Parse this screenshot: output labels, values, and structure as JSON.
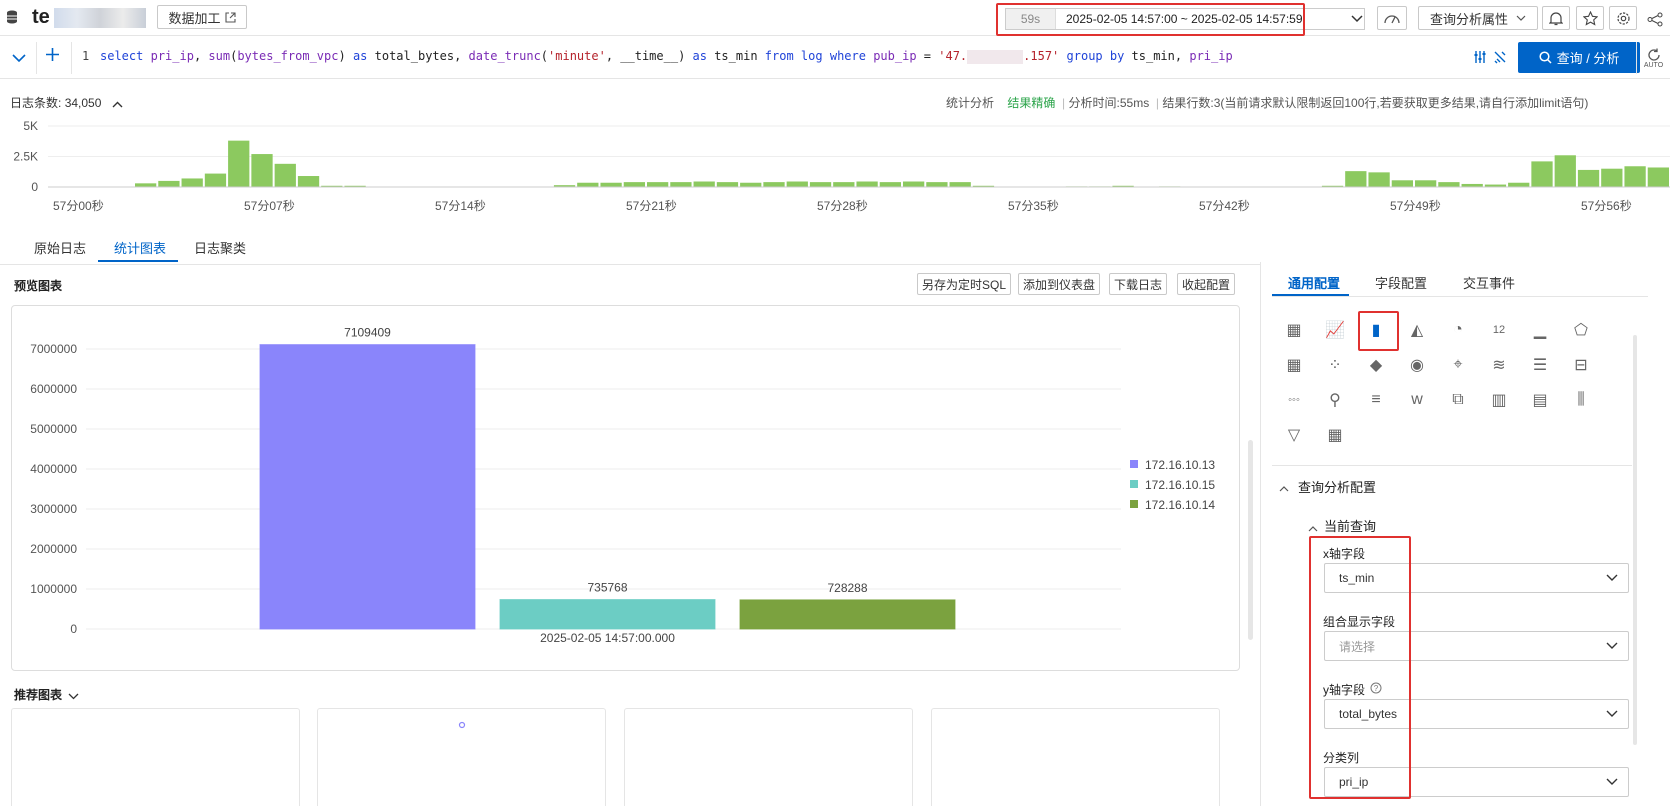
{
  "header": {
    "logstore_name": "te",
    "data_processing_label": "数据加工",
    "time_badge": "59s",
    "time_range": "2025-02-05 14:57:00 ~ 2025-02-05 14:57:59",
    "query_attr_label": "查询分析属性"
  },
  "query": {
    "line_no": "1",
    "run_label": "查询 / 分析",
    "auto_label": "AUTO"
  },
  "stats": {
    "log_count_label": "日志条数:",
    "log_count": "34,050",
    "analysis_label": "统计分析",
    "accuracy": "结果精确",
    "time_label": "分析时间:",
    "time_value": "55ms",
    "rows_label": "结果行数:",
    "rows_value": "3",
    "rows_note": "(当前请求默认限制返回100行,若要获取更多结果,请自行添加limit语句)"
  },
  "histogram": {
    "y_ticks": [
      "5K",
      "2.5K",
      "0"
    ],
    "x_ticks": [
      "57分00秒",
      "57分07秒",
      "57分14秒",
      "57分21秒",
      "57分28秒",
      "57分35秒",
      "57分42秒",
      "57分49秒",
      "57分56秒"
    ],
    "values": [
      0,
      0,
      0,
      0,
      0.3,
      0.5,
      0.7,
      1.1,
      3.8,
      2.7,
      1.9,
      0.9,
      0.1,
      0.1,
      0,
      0,
      0,
      0,
      0,
      0,
      0,
      0,
      0.15,
      0.35,
      0.35,
      0.4,
      0.4,
      0.4,
      0.45,
      0.4,
      0.35,
      0.4,
      0.45,
      0.4,
      0.4,
      0.45,
      0.4,
      0.45,
      0.4,
      0.4,
      0.1,
      0,
      0,
      0,
      0.05,
      0.05,
      0.1,
      0,
      0.05,
      0,
      0,
      0,
      0,
      0,
      0,
      0.1,
      1.3,
      1.2,
      0.55,
      0.55,
      0.4,
      0.25,
      0.2,
      0.35,
      2.1,
      2.6,
      1.4,
      1.5,
      1.7,
      1.6
    ]
  },
  "tabs": [
    "原始日志",
    "统计图表",
    "日志聚类"
  ],
  "preview": {
    "title": "预览图表",
    "buttons": [
      "另存为定时SQL",
      "添加到仪表盘",
      "下载日志",
      "收起配置"
    ]
  },
  "chart_data": {
    "type": "bar",
    "categories": [
      "2025-02-05 14:57:00.000"
    ],
    "series": [
      {
        "name": "172.16.10.13",
        "values": [
          7109409
        ],
        "color": "#8a85fb"
      },
      {
        "name": "172.16.10.15",
        "values": [
          735768
        ],
        "color": "#6ccdc4"
      },
      {
        "name": "172.16.10.14",
        "values": [
          728288
        ],
        "color": "#7ba23f"
      }
    ],
    "y_ticks": [
      0,
      1000000,
      2000000,
      3000000,
      4000000,
      5000000,
      6000000,
      7000000
    ],
    "ylim": [
      0,
      7600000
    ],
    "legend": "right",
    "grid": true
  },
  "recommend": {
    "title": "推荐图表"
  },
  "right_panel": {
    "tabs": [
      "通用配置",
      "字段配置",
      "交互事件"
    ],
    "section_title": "查询分析配置",
    "subsection_title": "当前查询",
    "fields": [
      {
        "label": "x轴字段",
        "value": "ts_min",
        "placeholder": false
      },
      {
        "label": "组合显示字段",
        "value": "请选择",
        "placeholder": true
      },
      {
        "label": "y轴字段",
        "value": "total_bytes",
        "placeholder": false
      },
      {
        "label": "分类列",
        "value": "pri_ip",
        "placeholder": false
      }
    ],
    "chart_icons": [
      "table-icon",
      "line-chart-icon",
      "bar-chart-icon",
      "area-chart-icon",
      "pie-chart-icon",
      "single-value-icon",
      "histogram-icon",
      "radar-icon",
      "calendar-icon",
      "scatter-icon",
      "china-map-icon",
      "world-map-icon",
      "geo-map-icon",
      "sankey-icon",
      "list-icon",
      "boxplot-icon",
      "flow-icon",
      "point-map-icon",
      "progress-icon",
      "word-cloud-icon",
      "topology-icon",
      "funnel-col-icon",
      "treemap-icon",
      "sequence-icon",
      "funnel-icon",
      "data-grid-icon"
    ]
  }
}
